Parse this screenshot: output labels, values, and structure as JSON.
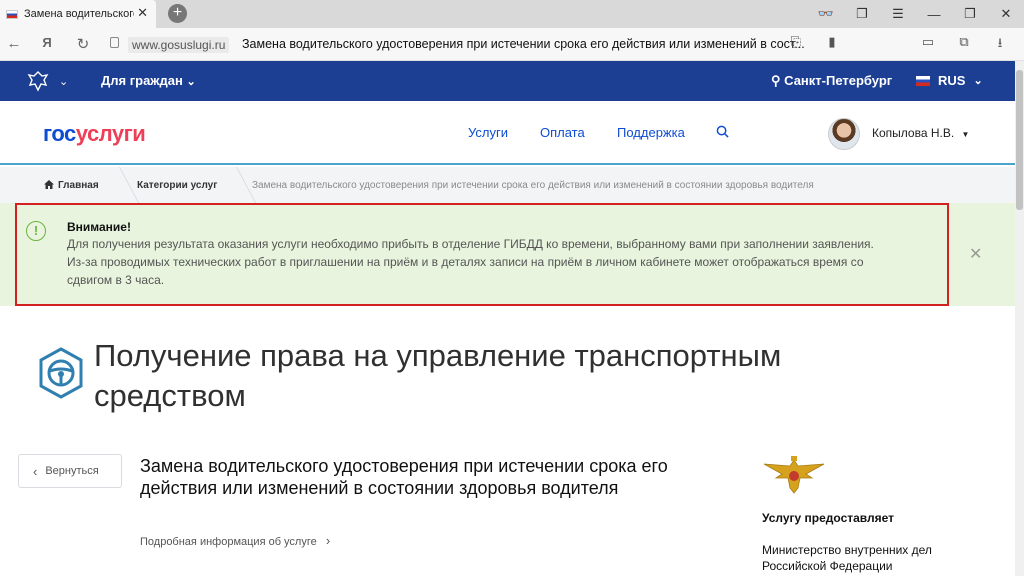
{
  "browser": {
    "tab_title": "Замена водительского",
    "tab_close": "✕",
    "new_tab": "+",
    "address_domain": "www.gosuslugi.ru",
    "address_title": "Замена водительского удостоверения при истечении срока его действия или изменений в сост..."
  },
  "topnav": {
    "for_citizens": "Для граждан",
    "city": "Санкт-Петербург",
    "language": "RUS"
  },
  "header": {
    "logo_part1": "гос",
    "logo_part2": "услуги",
    "nav": [
      "Услуги",
      "Оплата",
      "Поддержка"
    ],
    "user_name": "Копылова Н.В."
  },
  "breadcrumb": {
    "home": "Главная",
    "categories": "Категории услуг",
    "current": "Замена водительского удостоверения при истечении срока его действия или изменений в состоянии здоровья водителя"
  },
  "alert": {
    "title": "Внимание!",
    "line1": "Для получения результата оказания услуги необходимо прибыть в отделение ГИБДД ко времени, выбранному вами при заполнении заявления.",
    "line2": "Из-за проводимых технических работ в приглашении на приём и в деталях записи на приём в личном кабинете может отображаться время со сдвигом в 3 часа."
  },
  "page": {
    "title": "Получение права на управление транспортным средством",
    "back_label": "Вернуться",
    "service_title": "Замена водительского удостоверения при истечении срока его действия или изменений в состоянии здоровья водителя",
    "more_info": "Подробная информация об услуге",
    "provider_label": "Услугу предоставляет",
    "provider_name": "Министерство внутренних дел Российской Федерации"
  },
  "colors": {
    "brand_blue": "#0d4cd3",
    "brand_red": "#ee3f58",
    "topbar": "#1c3f94",
    "alert_bg": "#e8f4dd",
    "alert_frame": "#d32020"
  }
}
